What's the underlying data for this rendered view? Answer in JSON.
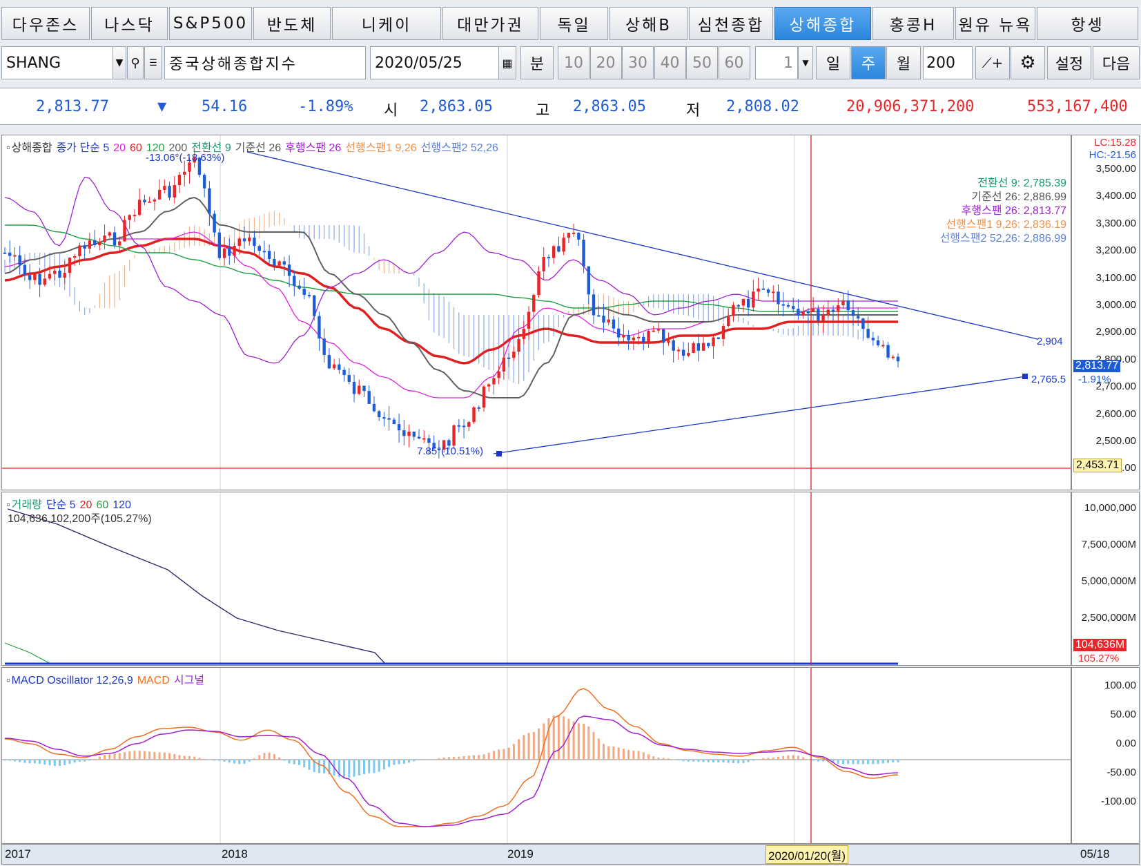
{
  "market_tabs": [
    {
      "label": "다우존스",
      "active": false
    },
    {
      "label": "나스닥",
      "active": false
    },
    {
      "label": "S&P500",
      "active": false
    },
    {
      "label": "반도체",
      "active": false
    },
    {
      "label": "니케이",
      "active": false
    },
    {
      "label": "대만가권",
      "active": false
    },
    {
      "label": "독일",
      "active": false
    },
    {
      "label": "상해B",
      "active": false
    },
    {
      "label": "심천종합",
      "active": false
    },
    {
      "label": "상해종합",
      "active": true
    },
    {
      "label": "홍콩H",
      "active": false
    },
    {
      "label": "원유 뉴욕",
      "active": false
    },
    {
      "label": "항셍",
      "active": false
    }
  ],
  "toolbar": {
    "symbol": "SHANG",
    "name": "중국상해종합지수",
    "date": "2020/05/25",
    "minute_label": "분",
    "minute_options": [
      "10",
      "20",
      "30",
      "40",
      "50",
      "60"
    ],
    "tick_value": "1",
    "period_day": "일",
    "period_week": "주",
    "period_month": "월",
    "count": "200",
    "settings_label": "설정",
    "next_label": "다음"
  },
  "quote": {
    "price": "2,813.77",
    "direction": "▼",
    "change": "54.16",
    "change_pct": "-1.89%",
    "open_label": "시",
    "open": "2,863.05",
    "high_label": "고",
    "high": "2,863.05",
    "low_label": "저",
    "low": "2,808.02",
    "volume": "20,906,371,200",
    "amount": "553,167,400"
  },
  "colors": {
    "up": "#e8262a",
    "down": "#1e5cd6",
    "accent": "#2b86dc"
  },
  "price_panel": {
    "legend": [
      {
        "text": "상해종합",
        "color": "#333"
      },
      {
        "text": "종가 단순 5",
        "color": "#1c38c8"
      },
      {
        "text": "20",
        "color": "#e020e0"
      },
      {
        "text": "60",
        "color": "#e02020"
      },
      {
        "text": "120",
        "color": "#20a040"
      },
      {
        "text": "200",
        "color": "#606060"
      },
      {
        "text": "전환선 9",
        "color": "#159a6a"
      },
      {
        "text": "기준선 26",
        "color": "#555"
      },
      {
        "text": "후행스팬 26",
        "color": "#a020d0"
      },
      {
        "text": "선행스팬1 9,26",
        "color": "#f0904a"
      },
      {
        "text": "선행스팬2 52,26",
        "color": "#5b7fd8"
      }
    ],
    "values": [
      {
        "text": "전환선 9: 2,785.39",
        "color": "#159a6a"
      },
      {
        "text": "기준선 26: 2,886.99",
        "color": "#555"
      },
      {
        "text": "후행스팬 26: 2,813.77",
        "color": "#a020d0"
      },
      {
        "text": "선행스팬1 9,26: 2,836.19",
        "color": "#f0904a"
      },
      {
        "text": "선행스팬2 52,26: 2,886.99",
        "color": "#5b7fd8"
      }
    ],
    "lc": "LC:15.28",
    "hc": "HC:-21.56",
    "high_note": "-13.06°(-18.63%)",
    "low_note": "7.85°(10.51%)",
    "trend_top": "2,904",
    "trend_bottom": "2,765.5",
    "last_price": "2,813.77",
    "last_pct": "-1.91%",
    "hline_price": "2,453.71",
    "y_ticks": [
      "3,500.00",
      "3,400.00",
      "3,300.00",
      "3,200.00",
      "3,100.00",
      "3,000.00",
      "2,900.00",
      "2,800.00",
      "2,700.00",
      "2,600.00",
      "2,500.00",
      "2,400.00"
    ]
  },
  "volume_panel": {
    "legend": [
      {
        "text": "거래량",
        "color": "#159a6a"
      },
      {
        "text": "단순 5",
        "color": "#1c38c8"
      },
      {
        "text": "20",
        "color": "#e02020"
      },
      {
        "text": "60",
        "color": "#20a040"
      },
      {
        "text": "120",
        "color": "#1c38c8"
      }
    ],
    "note": "104,636,102,200주(105.27%)",
    "y_ticks": [
      "10,000,000",
      "7,500,000M",
      "5,000,000M",
      "2,500,000M"
    ],
    "last": "104,636M",
    "last_pct": "105.27%"
  },
  "macd_panel": {
    "legend": [
      {
        "text": "MACD Oscillator 12,26,9",
        "color": "#1c38c8"
      },
      {
        "text": "MACD",
        "color": "#f07020"
      },
      {
        "text": "시그널",
        "color": "#a020d0"
      }
    ],
    "y_ticks": [
      "100.00",
      "50.00",
      "0.00",
      "-50.00",
      "-100.00"
    ]
  },
  "x_axis": {
    "labels": [
      "2017",
      "2018",
      "2019"
    ],
    "cursor": "2020/01/20(월)",
    "right": "05/18"
  }
}
